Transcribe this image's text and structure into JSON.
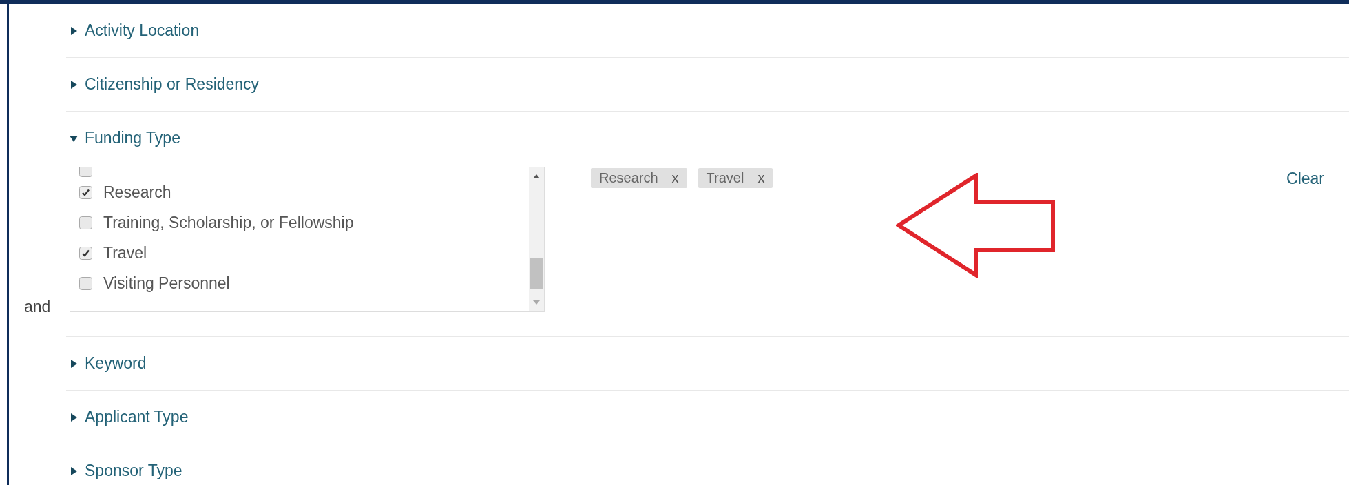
{
  "sections": [
    {
      "title": "Activity Location",
      "expanded": false
    },
    {
      "title": "Citizenship or Residency",
      "expanded": false
    },
    {
      "title": "Funding Type",
      "expanded": true,
      "conjunction": "and",
      "options": [
        {
          "checked": false
        },
        {
          "label": "Research",
          "checked": true
        },
        {
          "label": "Training, Scholarship, or Fellowship",
          "checked": false
        },
        {
          "label": "Travel",
          "checked": true
        },
        {
          "label": "Visiting Personnel",
          "checked": false
        }
      ],
      "chips": [
        {
          "label": "Research",
          "remove": "x"
        },
        {
          "label": "Travel",
          "remove": "x"
        }
      ],
      "clear": "Clear"
    },
    {
      "title": "Keyword",
      "expanded": false
    },
    {
      "title": "Applicant Type",
      "expanded": false
    },
    {
      "title": "Sponsor Type",
      "expanded": false
    }
  ]
}
